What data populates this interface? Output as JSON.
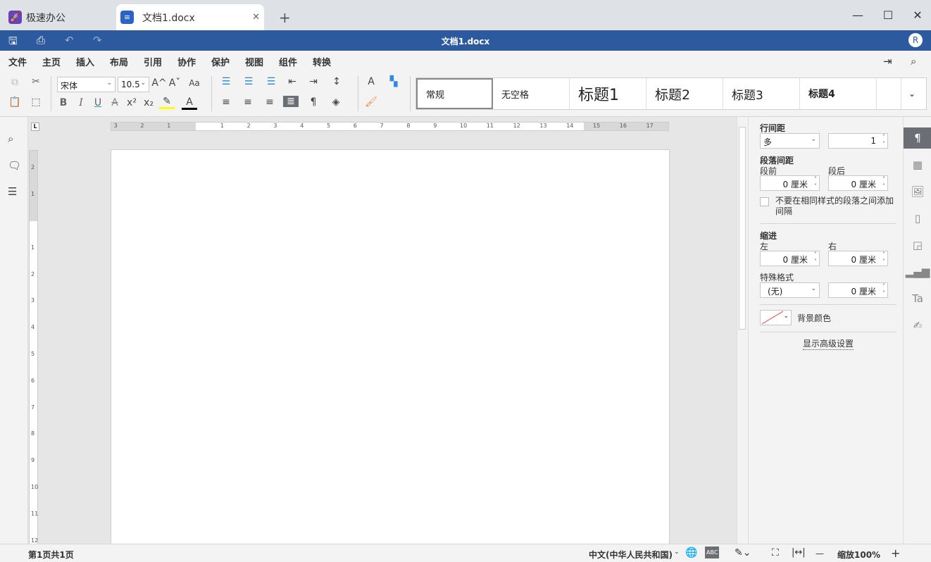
{
  "tabs": {
    "home": "极速办公",
    "doc": "文档1.docx",
    "new": "+"
  },
  "window": {
    "minimize": "—",
    "maximize": "☐",
    "close": "✕"
  },
  "title": "文档1.docx",
  "user_initial": "R",
  "menu": [
    "文件",
    "主页",
    "插入",
    "布局",
    "引用",
    "协作",
    "保护",
    "视图",
    "组件",
    "转换"
  ],
  "toolbar": {
    "font": "宋体",
    "size": "10.5",
    "bold": "B",
    "italic": "I",
    "underline": "U",
    "strike": "A",
    "sup": "x²",
    "sub": "x₂",
    "grow": "A^",
    "shrink": "Aˇ",
    "case": "Aa"
  },
  "styles": [
    "常规",
    "无空格",
    "标题1",
    "标题2",
    "标题3",
    "标题4"
  ],
  "ruler": {
    "h_left": [
      "3",
      "2",
      "1"
    ],
    "h_right": [
      "1",
      "2",
      "3",
      "4",
      "5",
      "6",
      "7",
      "8",
      "9",
      "10",
      "11",
      "12",
      "13",
      "14",
      "15",
      "16",
      "17"
    ],
    "v_top": [
      "2",
      "1"
    ],
    "v_main": [
      "1",
      "2",
      "3",
      "4",
      "5",
      "6",
      "7",
      "8",
      "9",
      "10",
      "11",
      "12"
    ]
  },
  "panel": {
    "line_spacing": "行间距",
    "line_mode": "多",
    "line_value": "1",
    "para_spacing": "段落间距",
    "before": "段前",
    "after": "段后",
    "before_val": "0 厘米",
    "after_val": "0 厘米",
    "no_space_check": "不要在相同样式的段落之间添加间隔",
    "indent": "缩进",
    "left": "左",
    "right": "右",
    "left_val": "0 厘米",
    "right_val": "0 厘米",
    "special": "特殊格式",
    "special_mode": "(无)",
    "special_val": "0 厘米",
    "bg_color": "背景颜色",
    "advanced": "显示高级设置"
  },
  "status": {
    "pages": "第1页共1页",
    "language": "中文(中华人民共和国)",
    "zoom": "缩放100%",
    "minus": "—",
    "plus": "+"
  },
  "colors": {
    "accent": "#2d5a9e",
    "highlight": "#ffff00",
    "font_color": "#000000"
  }
}
